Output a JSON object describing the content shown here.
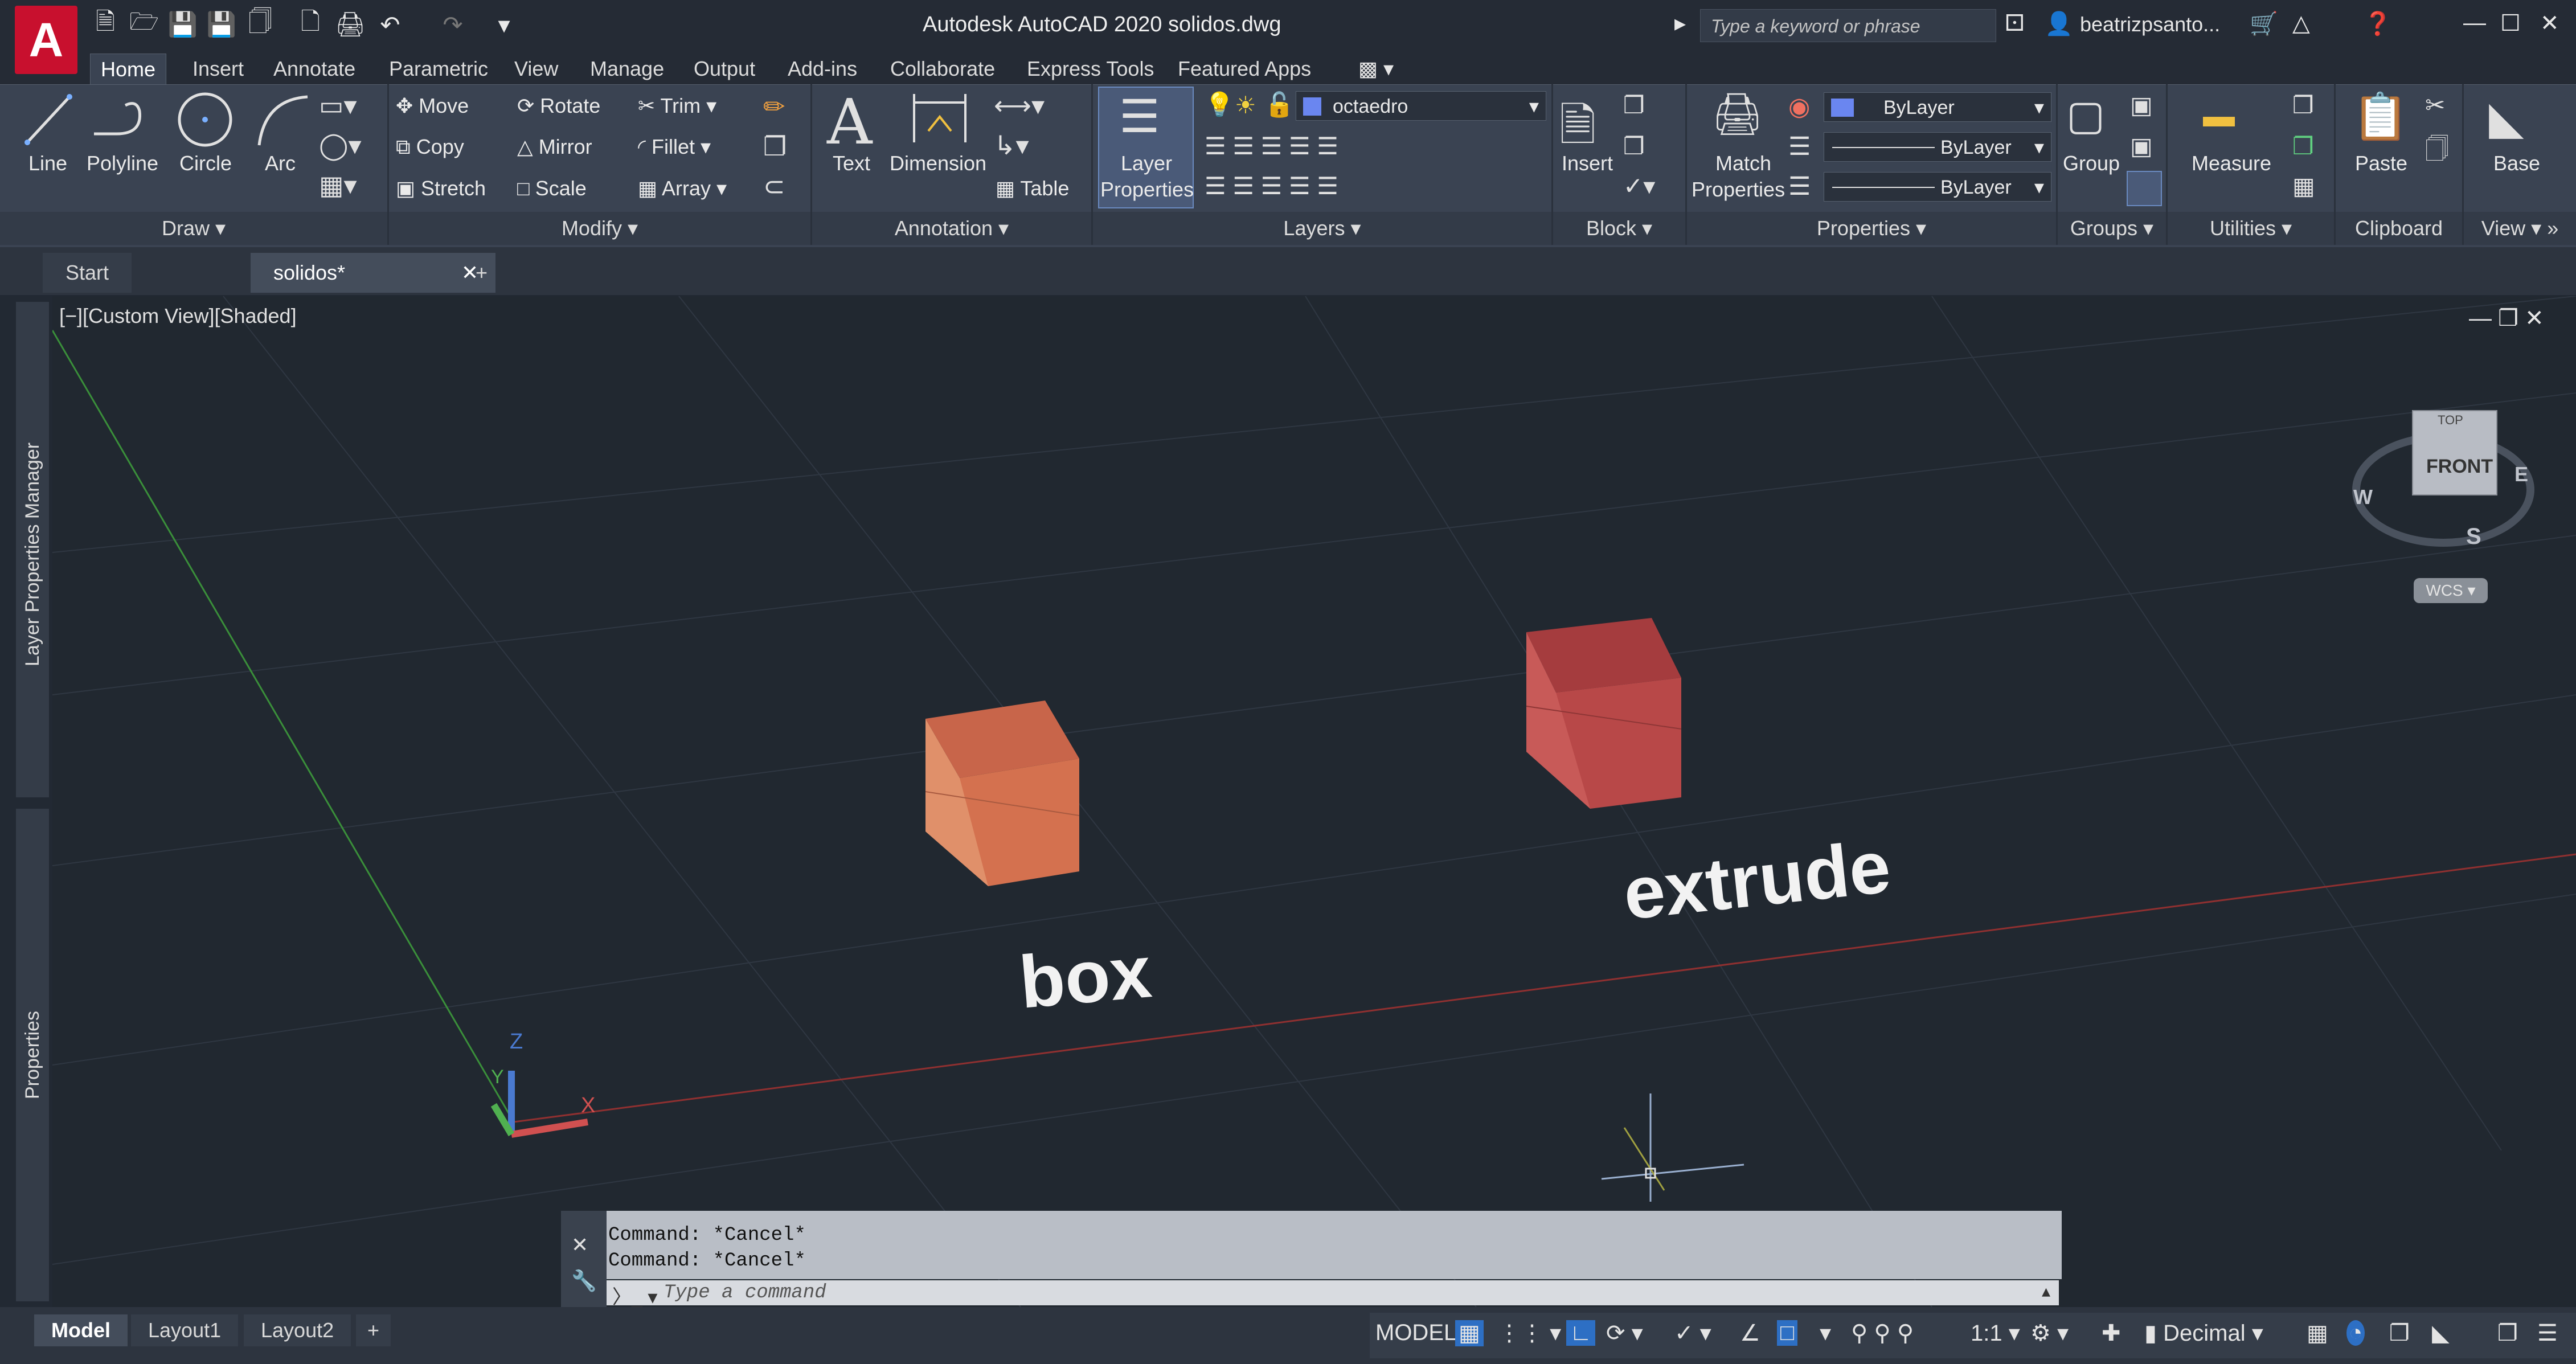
{
  "app": {
    "logo_letter": "A",
    "title": "Autodesk AutoCAD 2020   solidos.dwg",
    "search_placeholder": "Type a keyword or phrase",
    "user": "beatrizpsanto..."
  },
  "ribbon_tabs": [
    "Home",
    "Insert",
    "Annotate",
    "Parametric",
    "View",
    "Manage",
    "Output",
    "Add-ins",
    "Collaborate",
    "Express Tools",
    "Featured Apps"
  ],
  "draw": {
    "line": "Line",
    "polyline": "Polyline",
    "circle": "Circle",
    "arc": "Arc",
    "footer": "Draw"
  },
  "modify": {
    "move": "Move",
    "rotate": "Rotate",
    "trim": "Trim",
    "copy": "Copy",
    "mirror": "Mirror",
    "fillet": "Fillet",
    "stretch": "Stretch",
    "scale": "Scale",
    "array": "Array",
    "footer": "Modify"
  },
  "annotation": {
    "text": "Text",
    "dimension": "Dimension",
    "table": "Table",
    "footer": "Annotation"
  },
  "layers": {
    "layer_properties_1": "Layer",
    "layer_properties_2": "Properties",
    "current_layer": "octaedro",
    "footer": "Layers"
  },
  "block": {
    "insert": "Insert",
    "footer": "Block"
  },
  "properties": {
    "match_1": "Match",
    "match_2": "Properties",
    "color": "ByLayer",
    "linetype": "ByLayer",
    "lineweight": "ByLayer",
    "footer": "Properties"
  },
  "groups": {
    "group": "Group",
    "footer": "Groups"
  },
  "utilities": {
    "measure": "Measure",
    "footer": "Utilities"
  },
  "clipboard": {
    "paste": "Paste",
    "footer": "Clipboard"
  },
  "view_panel": {
    "base": "Base",
    "footer": "View"
  },
  "doc_tabs": {
    "start": "Start",
    "solidos": "solidos*"
  },
  "viewport": {
    "label": "[−][Custom View][Shaded]",
    "text_box": "box",
    "text_extrude": "extrude",
    "viewcube_top": "TOP",
    "viewcube_front": "FRONT",
    "compass_w": "W",
    "compass_e": "E",
    "compass_s": "S",
    "wcs": "WCS",
    "ucs_x": "X",
    "ucs_y": "Y",
    "ucs_z": "Z"
  },
  "side_palettes": {
    "layer_manager": "Layer Properties Manager",
    "properties": "Properties"
  },
  "command": {
    "line1": "Command: *Cancel*",
    "line2": "Command: *Cancel*",
    "placeholder": "Type a command"
  },
  "layout_tabs": [
    "Model",
    "Layout1",
    "Layout2"
  ],
  "status": {
    "model": "MODEL",
    "scale": "1:1",
    "units": "Decimal"
  },
  "colors": {
    "box_front": "#d4714f",
    "box_side": "#e0906a",
    "box_top": "#c8654a",
    "extrude_front": "#b84848",
    "extrude_side": "#c85a58",
    "extrude_top": "#a53c3e",
    "layer_swatch": "#6a86f0",
    "accent_highlight": "#2d6fc4"
  }
}
